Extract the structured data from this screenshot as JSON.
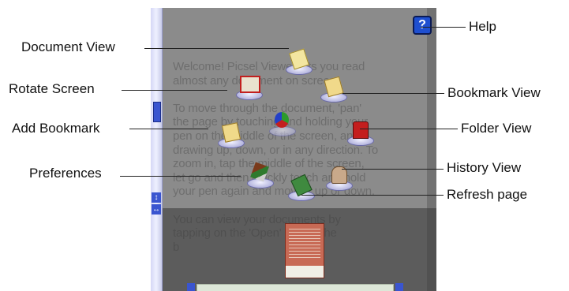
{
  "document_text": "Welcome! Picsel Viewer lets you read\nalmost any document on screen.\n\nTo move through the document, 'pan'\nthe page by touching and holding your\npen on the middle of the screen, and\ndrawing up, down, or in any direction. To\nzoom in, tap the middle of the screen,\nlet go and then quickly touch and hold\nyour pen again and move it up or down.\n\nYou can view your documents by\ntapping on the 'Open' icon in the\nb",
  "callouts": {
    "help": "Help",
    "document_view": "Document View",
    "rotate_screen": "Rotate Screen",
    "bookmark_view": "Bookmark View",
    "add_bookmark": "Add Bookmark",
    "folder_view": "Folder View",
    "history_view": "History View",
    "preferences": "Preferences",
    "refresh_page": "Refresh page"
  },
  "help_glyph": "?",
  "scroll_glyphs": {
    "up_down": "↕",
    "left_right": "↔"
  },
  "colors": {
    "accent_blue": "#3a55d0",
    "screen_gray": "#8b8b8b",
    "page_thumb": "#c86a55"
  }
}
